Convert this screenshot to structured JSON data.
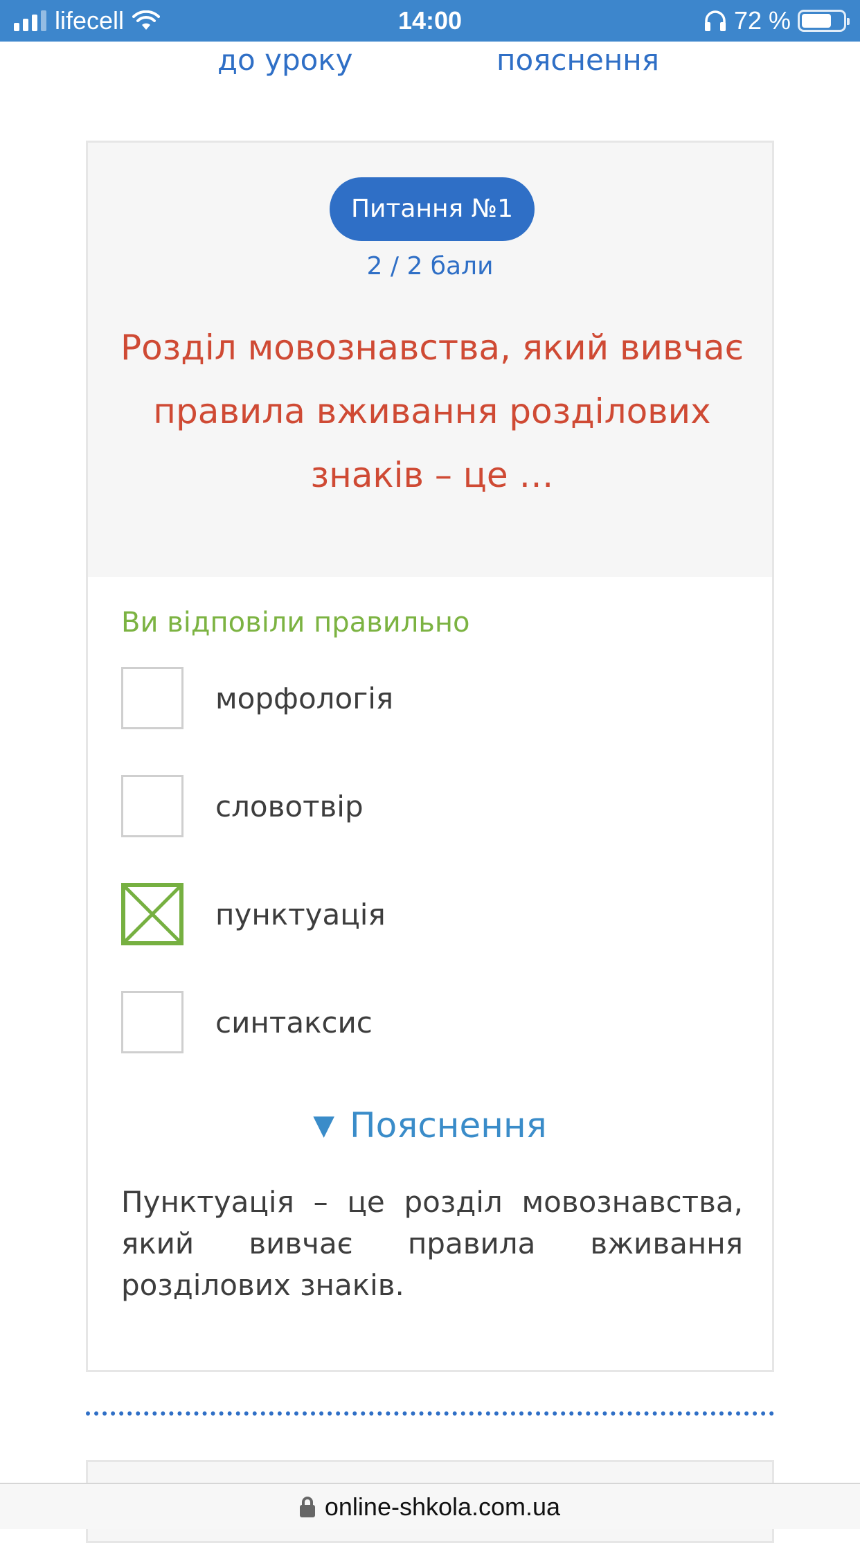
{
  "status_bar": {
    "carrier": "lifecell",
    "time": "14:00",
    "battery_percent": "72 %",
    "battery_level": 0.72,
    "icons": [
      "signal-icon",
      "wifi-icon",
      "headphones-icon",
      "battery-icon"
    ]
  },
  "top_links": {
    "lesson": "до уроку",
    "explanation": "пояснення"
  },
  "question": {
    "badge": "Питання №1",
    "score": "2 / 2 бали",
    "text": "Розділ мовознавства, який вивчає правила вживання розділових знаків  – це …"
  },
  "result": "Ви відповіли правильно",
  "options": [
    {
      "label": "морфологія",
      "checked": false
    },
    {
      "label": "словотвір",
      "checked": false
    },
    {
      "label": "пунктуація",
      "checked": true
    },
    {
      "label": "синтаксис",
      "checked": false
    }
  ],
  "explanation": {
    "toggle_label": "Пояснення",
    "text": "Пунктуація – це розділ мовознавства, який вивчає правила вживання розділових знаків."
  },
  "address_bar": {
    "url": "online-shkola.com.ua"
  },
  "colors": {
    "status_bar": "#3d86cc",
    "link": "#2f6fc6",
    "question_text": "#cf4a34",
    "correct": "#7cb342",
    "explain_toggle": "#3a8cc9"
  }
}
